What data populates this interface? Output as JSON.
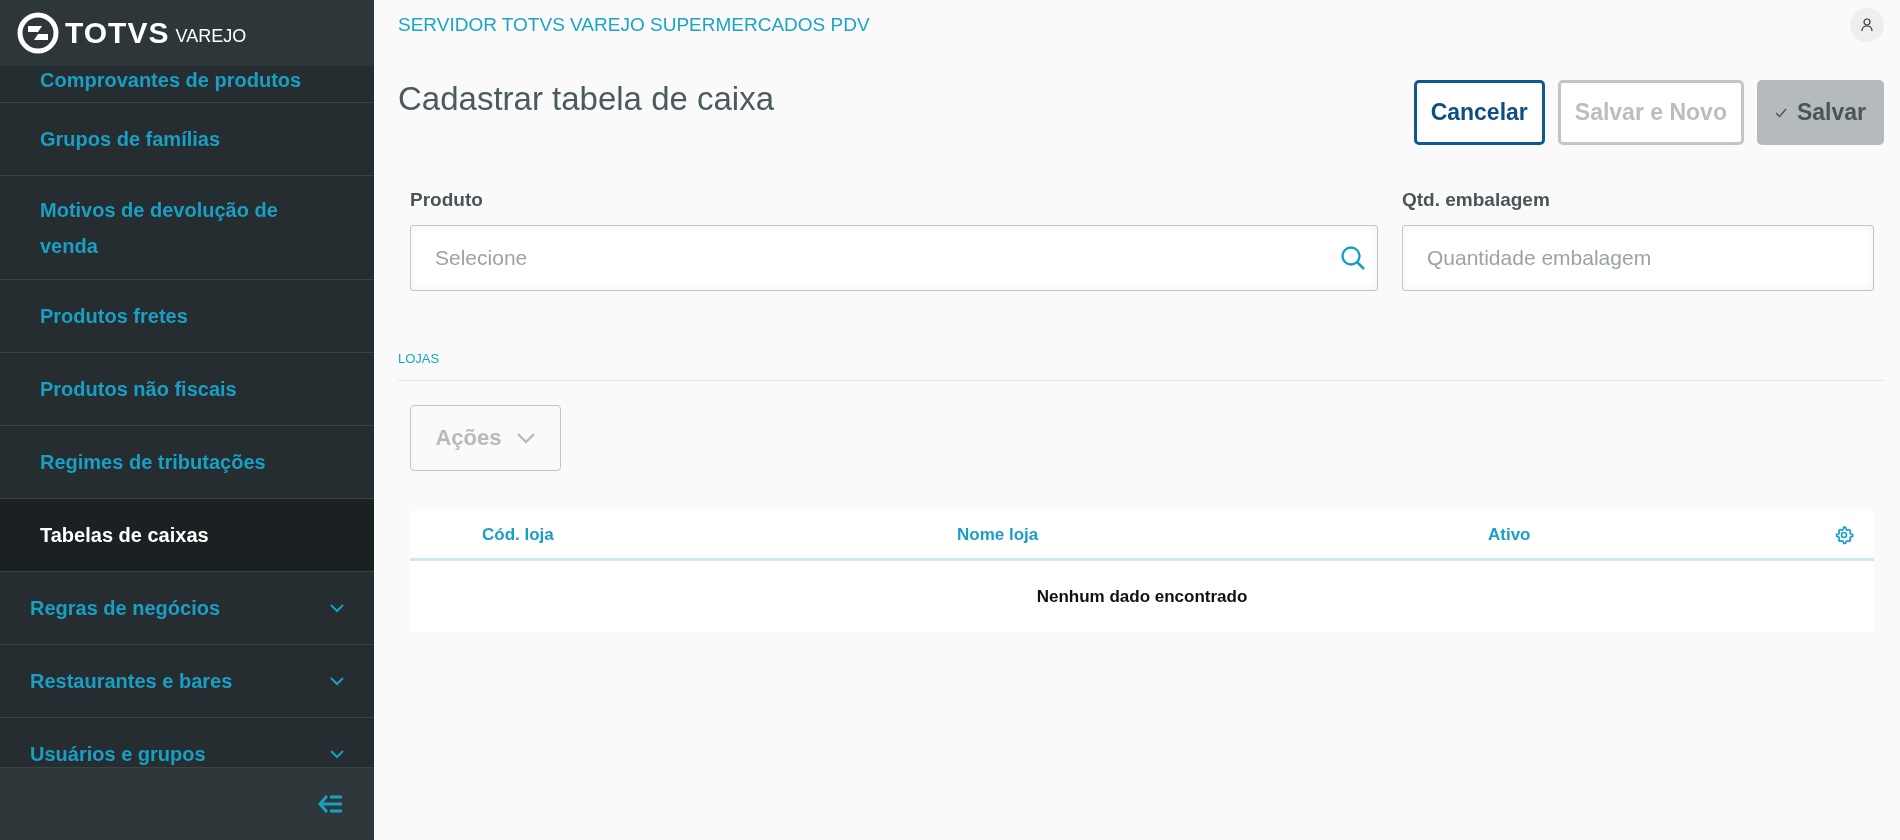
{
  "brand": {
    "name": "TOTVS",
    "product": "VAREJO"
  },
  "sidebar": {
    "items": [
      {
        "label": "Comprovantes de produtos",
        "kind": "sub",
        "selected": false
      },
      {
        "label": "Grupos de famílias",
        "kind": "sub",
        "selected": false
      },
      {
        "label": "Motivos de devolução de venda",
        "kind": "sub",
        "selected": false
      },
      {
        "label": "Produtos fretes",
        "kind": "sub",
        "selected": false
      },
      {
        "label": "Produtos não fiscais",
        "kind": "sub",
        "selected": false
      },
      {
        "label": "Regimes de tributações",
        "kind": "sub",
        "selected": false
      },
      {
        "label": "Tabelas de caixas",
        "kind": "sub",
        "selected": true
      },
      {
        "label": "Regras de negócios",
        "kind": "group",
        "expanded": false
      },
      {
        "label": "Restaurantes e bares",
        "kind": "group",
        "expanded": false
      },
      {
        "label": "Usuários e grupos",
        "kind": "group",
        "expanded": false
      }
    ]
  },
  "header": {
    "title": "SERVIDOR TOTVS VAREJO SUPERMERCADOS PDV"
  },
  "page": {
    "title": "Cadastrar tabela de caixa",
    "buttons": [
      {
        "label": "Cancelar",
        "kind": "secondary",
        "disabled": false
      },
      {
        "label": "Salvar e Novo",
        "kind": "secondary",
        "disabled": true
      },
      {
        "label": "Salvar",
        "kind": "primary",
        "disabled": true
      }
    ],
    "fields": [
      {
        "label": "Produto",
        "placeholder": "Selecione",
        "kind": "lookup"
      },
      {
        "label": "Qtd. embalagem",
        "placeholder": "Quantidade embalagem",
        "kind": "text"
      }
    ],
    "section": "LOJAS",
    "actions": {
      "label": "Ações",
      "disabled": true
    },
    "table": {
      "columns": [
        "Cód. loja",
        "Nome loja",
        "Ativo"
      ],
      "empty_message": "Nenhum dado encontrado"
    }
  }
}
